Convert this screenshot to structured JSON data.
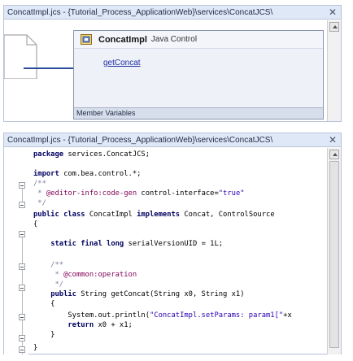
{
  "top_panel": {
    "title": "ConcatImpl.jcs - {Tutorial_Process_ApplicationWeb}\\services\\ConcatJCS\\",
    "control": {
      "name": "ConcatImpl",
      "type": "Java Control",
      "method": "getConcat",
      "footer": "Member Variables"
    }
  },
  "bottom_panel": {
    "title": "ConcatImpl.jcs - {Tutorial_Process_ApplicationWeb}\\services\\ConcatJCS\\",
    "code": [
      {
        "kw": "package",
        "rest": " services.ConcatJCS;"
      },
      {
        "kw": "import",
        "rest": " com.bea.control.*;"
      },
      {
        "cm": "/**"
      },
      {
        "cmpre": " * ",
        "ann": "@editor-info:code-gen",
        "rest": " control-interface=",
        "str": "\"true\""
      },
      {
        "cm": " */"
      },
      {
        "kw": "public class",
        "rest": " ConcatImpl ",
        "kw2": "implements",
        "rest2": " Concat, ControlSource"
      },
      {
        "rest": "{"
      },
      {
        "indent": "    ",
        "kw": "static final long",
        "rest": " serialVersionUID = 1L;"
      },
      {
        "cm": "    /**"
      },
      {
        "cmpre": "     * ",
        "ann": "@common:operation"
      },
      {
        "cm": "     */"
      },
      {
        "indent": "    ",
        "kw": "public",
        "rest": " String getConcat(String x0, String x1)"
      },
      {
        "rest": "    {"
      },
      {
        "rest": "        System.out.println(",
        "str": "\"ConcatImpl.setParams: param1[\"",
        "rest2": "+x"
      },
      {
        "indent": "        ",
        "kw": "return",
        "rest": " x0 + x1;"
      },
      {
        "rest": "    }"
      },
      {
        "rest": "}"
      }
    ]
  },
  "colors": {
    "title_bar": "#dfe8f6",
    "border": "#b7c3d8",
    "control_fill": "#eef1f7",
    "member_bar": "#d7deeb",
    "link": "#1f2fa3",
    "arrow": "#2a4a9a"
  },
  "icons": {
    "close": "close-icon",
    "scroll_up": "scroll-up-icon",
    "control": "java-control-icon",
    "document": "document-shape-icon",
    "arrow": "arrow-right-icon"
  }
}
